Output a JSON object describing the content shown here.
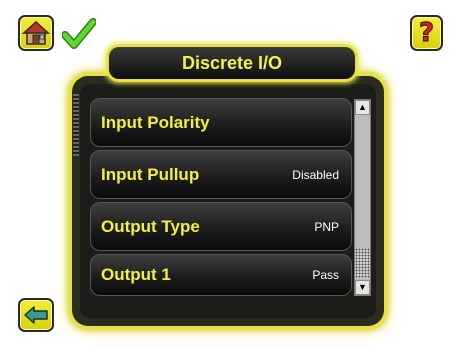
{
  "header": {
    "title": "Discrete I/O"
  },
  "list": {
    "items": [
      {
        "label": "Input Polarity",
        "value": ""
      },
      {
        "label": "Input Pullup",
        "value": "Disabled"
      },
      {
        "label": "Output Type",
        "value": "PNP"
      },
      {
        "label": "Output 1",
        "value": "Pass"
      }
    ]
  },
  "icons": {
    "home": "home-icon",
    "status": "checkmark-icon",
    "help": "question-mark-icon",
    "back": "back-arrow-icon",
    "scroll_up": "scroll-up-arrow-icon",
    "scroll_down": "scroll-down-arrow-icon"
  },
  "help": {
    "symbol": "?"
  },
  "scroll": {
    "up_symbol": "▲",
    "down_symbol": "▼"
  },
  "colors": {
    "accent_yellow": "#f2ec3a",
    "label_yellow": "#f4ef3c",
    "panel_dark": "#1c1c18",
    "check_green": "#4ec626"
  }
}
